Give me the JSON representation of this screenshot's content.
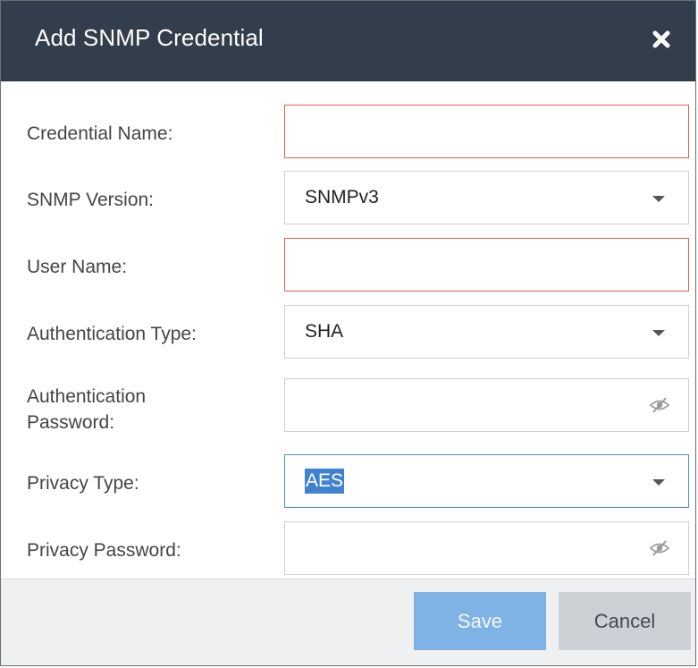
{
  "dialog": {
    "title": "Add SNMP Credential",
    "close_icon": "close-icon"
  },
  "form": {
    "credential_name": {
      "label": "Credential Name:",
      "value": ""
    },
    "snmp_version": {
      "label": "SNMP Version:",
      "value": "SNMPv3"
    },
    "user_name": {
      "label": "User Name:",
      "value": ""
    },
    "auth_type": {
      "label": "Authentication Type:",
      "value": "SHA"
    },
    "auth_password": {
      "label_line1": "Authentication",
      "label_line2": "Password:",
      "value": ""
    },
    "privacy_type": {
      "label": "Privacy Type:",
      "value": "AES"
    },
    "privacy_password": {
      "label": "Privacy Password:",
      "value": ""
    }
  },
  "footer": {
    "save_label": "Save",
    "cancel_label": "Cancel"
  },
  "colors": {
    "titlebar": "#333e4c",
    "error_border": "#d9644a",
    "focus_border": "#4d8fd4",
    "save_button": "#7fb3e5",
    "cancel_button": "#cdd1d5"
  }
}
